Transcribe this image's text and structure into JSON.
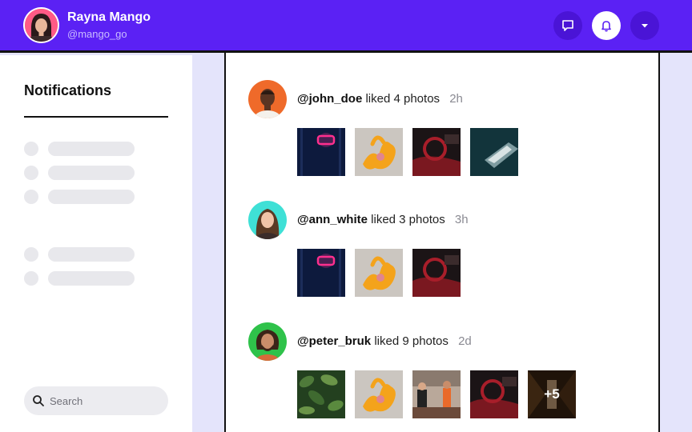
{
  "header": {
    "user_name": "Rayna Mango",
    "user_handle": "@mango_go",
    "buttons": [
      {
        "name": "messages",
        "icon": "chat-icon"
      },
      {
        "name": "notifications",
        "icon": "bell-icon",
        "active": true
      },
      {
        "name": "menu",
        "icon": "chevron-down-icon"
      }
    ]
  },
  "sidebar": {
    "title": "Notifications",
    "search": {
      "placeholder": "Search",
      "value": ""
    }
  },
  "feed": [
    {
      "user": "@john_doe",
      "action": "liked 4 photos",
      "time": "2h",
      "photos": [
        "neon-sign",
        "orange-coral",
        "car-interior",
        "teal-abstract"
      ]
    },
    {
      "user": "@ann_white",
      "action": "liked 3 photos",
      "time": "3h",
      "photos": [
        "neon-sign",
        "orange-coral",
        "car-interior"
      ]
    },
    {
      "user": "@peter_bruk",
      "action": "liked 9 photos",
      "time": "2d",
      "photos": [
        "green-leaves",
        "orange-coral",
        "people-in-cafe",
        "car-interior",
        "dark-building"
      ],
      "more_label": "+5"
    }
  ],
  "colors": {
    "header_bg": "#5b21f4",
    "page_bg": "#e4e4fb",
    "skeleton": "#e8e8ec"
  }
}
